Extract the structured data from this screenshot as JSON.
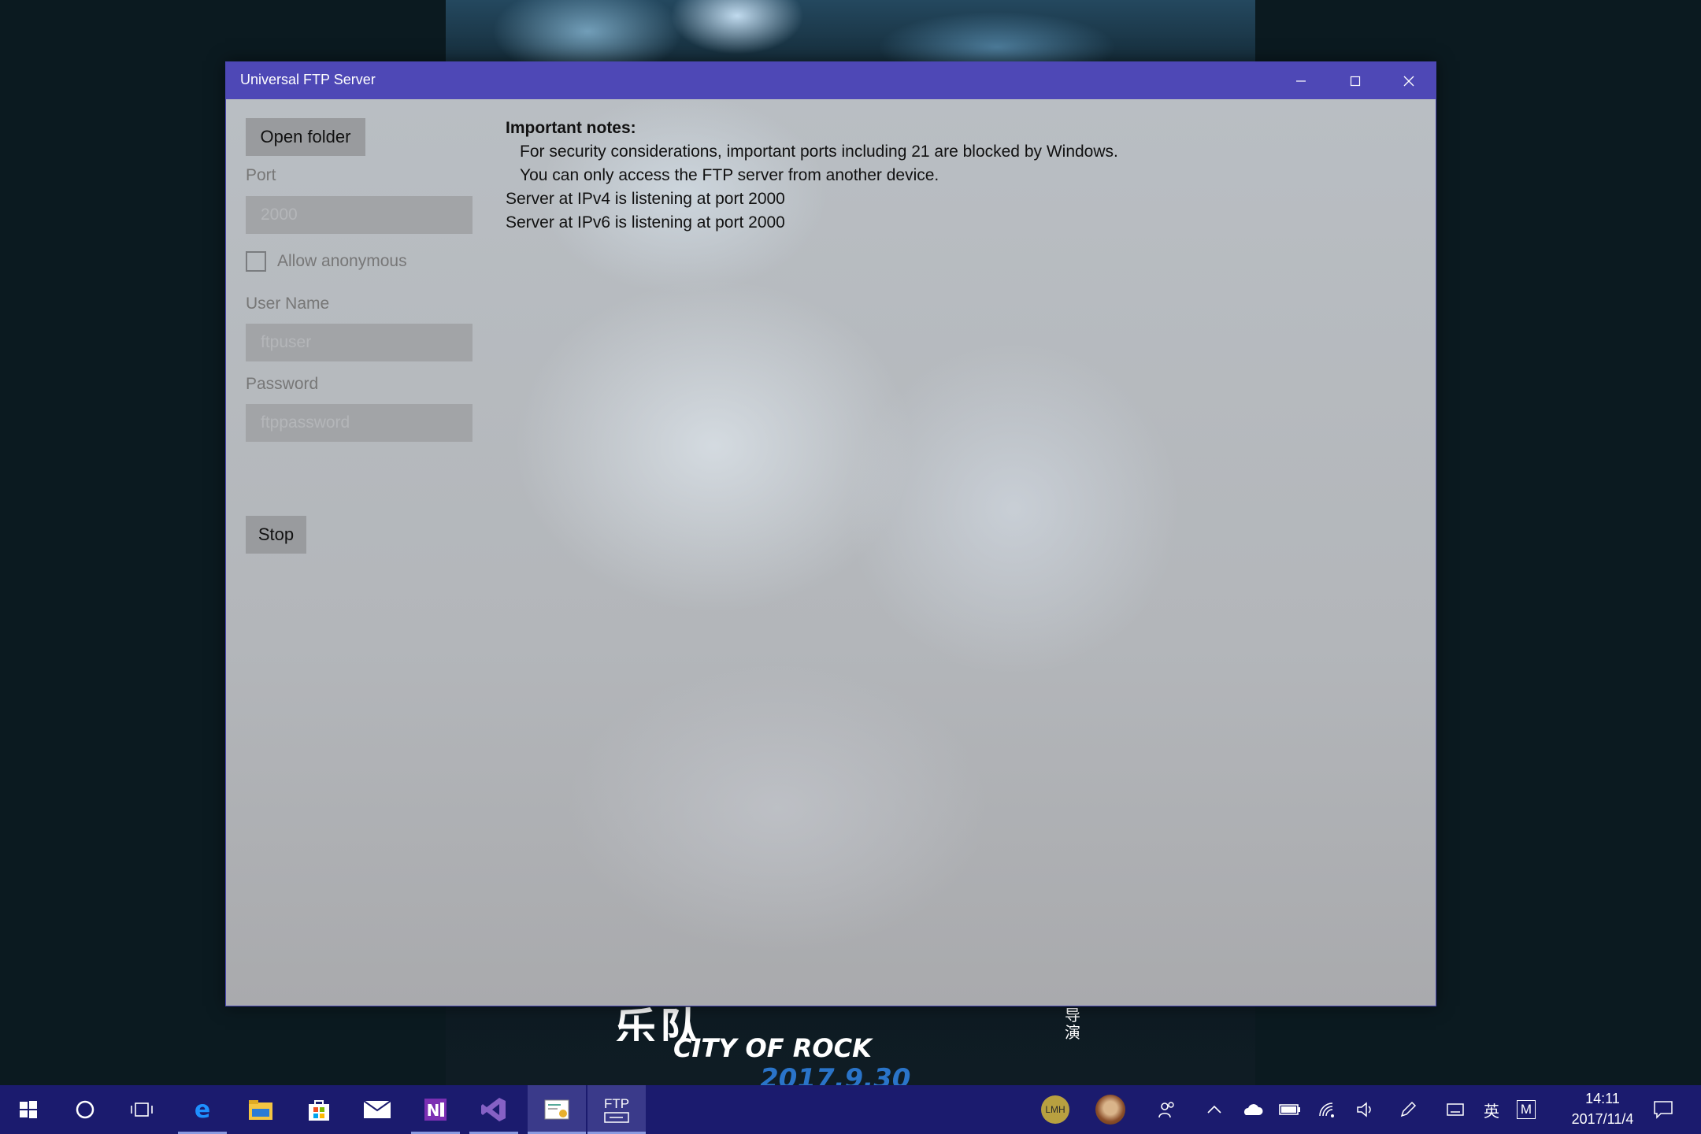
{
  "window": {
    "title": "Universal FTP Server",
    "caption": {
      "minimize": "minimize",
      "maximize": "maximize",
      "close": "close"
    }
  },
  "controls": {
    "open_folder_label": "Open folder",
    "port_label": "Port",
    "port_placeholder": "2000",
    "allow_anonymous_label": "Allow anonymous",
    "allow_anonymous_checked": false,
    "username_label": "User Name",
    "username_placeholder": "ftpuser",
    "password_label": "Password",
    "password_placeholder": "ftppassword",
    "stop_label": "Stop"
  },
  "log": {
    "heading": "Important notes:",
    "note1": "For security considerations, important ports including 21 are blocked by Windows.",
    "note2": "You can only access the FTP server from another device.",
    "line_ipv4": "Server at IPv4 is listening at port 2000",
    "line_ipv6": "Server at IPv6 is listening at port 2000"
  },
  "wallpaper": {
    "poster_title_cn": "乐队",
    "poster_title_en": "CITY OF ROCK",
    "poster_date": "2017.9.30",
    "poster_director": "导演"
  },
  "taskbar": {
    "apps": [
      "start-icon",
      "cortana-icon",
      "task-view-icon",
      "edge-icon",
      "file-explorer-icon",
      "store-icon",
      "mail-icon",
      "onenote-icon",
      "visual-studio-icon",
      "certificate-app-icon",
      "ftp-app-icon"
    ],
    "ftp_label": "FTP",
    "tray": {
      "avatar_initials": "LMH",
      "ime_label": "英",
      "ime_mode": "M",
      "time": "14:11",
      "date": "2017/11/4"
    }
  },
  "colors": {
    "titlebar": "#4e48b6",
    "taskbar": "#1b1b6e",
    "button": "#999b9e",
    "field": "#a2a4a7"
  }
}
